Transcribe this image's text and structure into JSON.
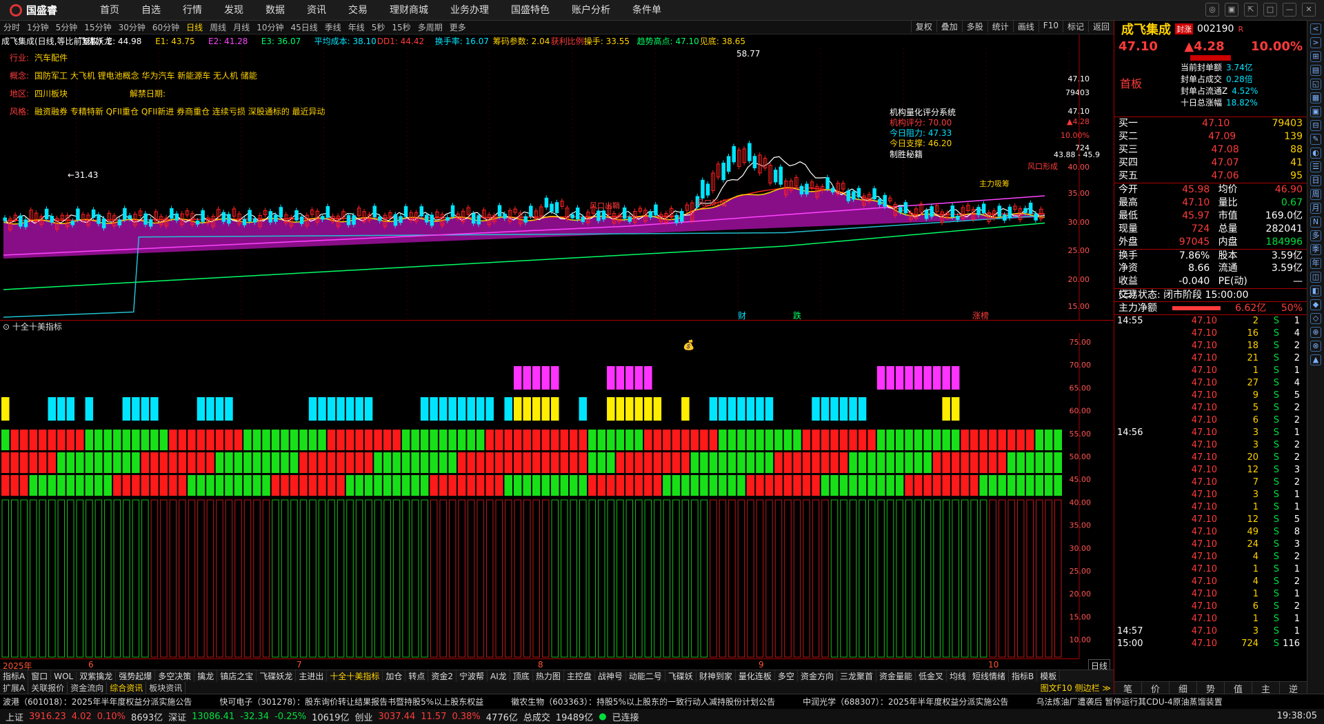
{
  "app": {
    "logo": "国盛睿",
    "menu": [
      "首页",
      "自选",
      "行情",
      "发现",
      "数据",
      "资讯",
      "交易",
      "理财商城",
      "业务办理",
      "国盛特色",
      "账户分析",
      "条件单"
    ],
    "window_controls": [
      "◎",
      "▣",
      "⇱",
      "□",
      "—",
      "✕"
    ]
  },
  "timeframes": {
    "items": [
      "分时",
      "1分钟",
      "5分钟",
      "15分钟",
      "30分钟",
      "60分钟",
      "日线",
      "周线",
      "月线",
      "10分钟",
      "45日线",
      "季线",
      "年线",
      "5秒",
      "15秒",
      "多周期",
      "更多"
    ],
    "selected": "日线",
    "tools": [
      "复权",
      "叠加",
      "多股",
      "统计",
      "画线",
      "F10",
      "标记",
      "返回"
    ]
  },
  "chart_header": {
    "items": [
      {
        "t": "成飞集成(日线,等比前复权)",
        "c": "#ffffff"
      },
      {
        "t": "飞碟妖龙",
        "c": "#ffffff"
      },
      {
        "t": "E: 44.98",
        "c": "#ffffff"
      },
      {
        "t": "E1: 43.75",
        "c": "#ffd200"
      },
      {
        "t": "E2: 41.28",
        "c": "#ff44ff"
      },
      {
        "t": "E3: 36.07",
        "c": "#00ff66"
      },
      {
        "t": "平均成本: 38.10",
        "c": "#00e5ff"
      },
      {
        "t": "DD1: 44.42",
        "c": "#ff3b3b"
      },
      {
        "t": "换手率: 16.07",
        "c": "#00e5ff"
      },
      {
        "t": "筹码参数: 2.04",
        "c": "#ffd200"
      },
      {
        "t": "获利比例:",
        "c": "#ff3b3b"
      },
      {
        "t": "操手: 33.55",
        "c": "#ffd200"
      },
      {
        "t": "趋势高点: 47.10",
        "c": "#00ff66"
      },
      {
        "t": "见底: 38.65",
        "c": "#ffd200"
      }
    ]
  },
  "info_lines": [
    {
      "label": "行业:",
      "text": "汽车配件"
    },
    {
      "label": "概念:",
      "text": "国防军工 大飞机 锂电池概念 华为汽车 新能源车 无人机 储能"
    },
    {
      "label": "地区:",
      "text": "四川板块",
      "extra": "解禁日期:"
    },
    {
      "label": "风格:",
      "text": "融资融券 专精特新 QFII重仓 QFII新进 券商重仓 连续亏损 深股通标的 最近异动"
    }
  ],
  "annotations": {
    "peak": "58.77",
    "low": "31.43",
    "score_title": "机构量化评分系统",
    "score": "机构评分: 70.00",
    "resistance": "今日阻力: 47.33",
    "support": "今日支撑: 46.20",
    "strategy": "制胜秘籍",
    "range": "43.88 - 45.9",
    "markers": [
      "财",
      "跌",
      "涨榜"
    ],
    "signals": [
      "风口出鞘",
      "风口形成",
      "主力吸筹",
      "风口形成"
    ]
  },
  "main_yaxis": [
    "47.10",
    "79403",
    "47.10",
    "▲4.28",
    "10.00%",
    "724",
    "40.00",
    "35.00",
    "30.00",
    "25.00",
    "20.00",
    "15.00"
  ],
  "sub_indicator": {
    "title": "十全十美指标",
    "yaxis": [
      "75.00",
      "70.00",
      "65.00",
      "60.00",
      "55.00",
      "50.00",
      "45.00",
      "40.00",
      "35.00",
      "30.00",
      "25.00",
      "20.00",
      "15.00",
      "10.00"
    ]
  },
  "dates": [
    "2025年",
    "6",
    "7",
    "8",
    "9",
    "10"
  ],
  "period_btn": "日线",
  "indicator_tabs": [
    "指标A",
    "窗口",
    "WOL",
    "双紫擒龙",
    "强势起爆",
    "多空决策",
    "擒龙",
    "镇店之宝",
    "飞碟妖龙",
    "主进出",
    "十全十美指标",
    "加仓",
    "转点",
    "资金2",
    "宁波帮",
    "AI龙",
    "顶底",
    "热力图",
    "主控盘",
    "战神号",
    "动能二号",
    "飞碟妖",
    "财神到家",
    "量化连板",
    "多空",
    "资金方向",
    "三龙聚首",
    "资金量能",
    "低金叉",
    "均线",
    "短线情绪",
    "指标B",
    "模板"
  ],
  "indicator_selected": "十全十美指标",
  "ext_tabs": [
    "扩展A",
    "关联报价",
    "资金流向",
    "综合资讯",
    "板块资讯"
  ],
  "ext_selected": "综合资讯",
  "ext_right": "图文F10 侧边栏 ≫",
  "news": [
    "波港（601018）：2025年半年度权益分派实施公告",
    "快可电子（301278）：股东询价转让结果报告书暨持股5%以上股东权益",
    "徽农生物（603363）：持股5%以上股东的一致行动人减持股份计划公告",
    "中润光学（688307）：2025年半年度权益分派实施公告",
    "乌法炼油厂遭袭后 暂停运行其CDU-4原油蒸馏装置"
  ],
  "status": {
    "sh_label": "上证",
    "sh": "3916.23",
    "sh_chg": "4.02",
    "sh_pct": "0.10%",
    "sh_amt": "8693亿",
    "sz_label": "深证",
    "sz": "13086.41",
    "sz_chg": "-32.34",
    "sz_pct": "-0.25%",
    "sz_amt": "10619亿",
    "cy_label": "创业",
    "cy": "3037.44",
    "cy_chg": "11.57",
    "cy_pct": "0.38%",
    "cy_amt": "4776亿",
    "total_label": "总成交",
    "total": "19489亿",
    "conn": "已连接",
    "time": "19:38:05"
  },
  "quote": {
    "name": "成飞集成",
    "tag": "封涨",
    "code": "002190",
    "r": "R",
    "price": "47.10",
    "change": "▲4.28",
    "pct": "10.00%",
    "board": "首板",
    "seal": [
      {
        "k": "当前封单额",
        "v": "3.74亿"
      },
      {
        "k": "封单占成交",
        "v": "0.28倍"
      },
      {
        "k": "封单占流通Z",
        "v": "4.52%"
      },
      {
        "k": "十日总涨幅",
        "v": "18.82%"
      }
    ],
    "book": [
      {
        "k": "买一",
        "p": "47.10",
        "v": "79403"
      },
      {
        "k": "买二",
        "p": "47.09",
        "v": "139"
      },
      {
        "k": "买三",
        "p": "47.08",
        "v": "88"
      },
      {
        "k": "买四",
        "p": "47.07",
        "v": "41"
      },
      {
        "k": "买五",
        "p": "47.06",
        "v": "95"
      }
    ],
    "stats": [
      {
        "k1": "今开",
        "v1": "45.98",
        "c1": "red",
        "k2": "均价",
        "v2": "46.90",
        "c2": "red"
      },
      {
        "k1": "最高",
        "v1": "47.10",
        "c1": "red",
        "k2": "量比",
        "v2": "0.67",
        "c2": "grn"
      },
      {
        "k1": "最低",
        "v1": "45.97",
        "c1": "red",
        "k2": "市值",
        "v2": "169.0亿",
        "c2": "wht"
      },
      {
        "k1": "现量",
        "v1": "724",
        "c1": "red",
        "k2": "总量",
        "v2": "282041",
        "c2": "wht"
      },
      {
        "k1": "外盘",
        "v1": "97045",
        "c1": "red",
        "k2": "内盘",
        "v2": "184996",
        "c2": "grn"
      },
      {
        "k1": "换手",
        "v1": "7.86%",
        "c1": "wht",
        "k2": "股本",
        "v2": "3.59亿",
        "c2": "wht"
      },
      {
        "k1": "净资",
        "v1": "8.66",
        "c1": "wht",
        "k2": "流通",
        "v2": "3.59亿",
        "c2": "wht"
      },
      {
        "k1": "收益(三)",
        "v1": "-0.040",
        "c1": "wht",
        "k2": "PE(动)",
        "v2": "—",
        "c2": "wht"
      }
    ],
    "trade_state": "交易状态: 闭市阶段 15:00:00",
    "flow_label": "主力净额",
    "flow": "6.62亿",
    "flow_pct": "50%",
    "ticks": [
      {
        "t": "14:55",
        "p": "47.10",
        "v": "2",
        "s": "S",
        "n": "1"
      },
      {
        "t": "",
        "p": "47.10",
        "v": "16",
        "s": "S",
        "n": "4"
      },
      {
        "t": "",
        "p": "47.10",
        "v": "18",
        "s": "S",
        "n": "2"
      },
      {
        "t": "",
        "p": "47.10",
        "v": "21",
        "s": "S",
        "n": "2"
      },
      {
        "t": "",
        "p": "47.10",
        "v": "1",
        "s": "S",
        "n": "1"
      },
      {
        "t": "",
        "p": "47.10",
        "v": "27",
        "s": "S",
        "n": "4"
      },
      {
        "t": "",
        "p": "47.10",
        "v": "9",
        "s": "S",
        "n": "5"
      },
      {
        "t": "",
        "p": "47.10",
        "v": "5",
        "s": "S",
        "n": "2"
      },
      {
        "t": "",
        "p": "47.10",
        "v": "6",
        "s": "S",
        "n": "2"
      },
      {
        "t": "14:56",
        "p": "47.10",
        "v": "3",
        "s": "S",
        "n": "1"
      },
      {
        "t": "",
        "p": "47.10",
        "v": "3",
        "s": "S",
        "n": "2"
      },
      {
        "t": "",
        "p": "47.10",
        "v": "20",
        "s": "S",
        "n": "2"
      },
      {
        "t": "",
        "p": "47.10",
        "v": "12",
        "s": "S",
        "n": "3"
      },
      {
        "t": "",
        "p": "47.10",
        "v": "7",
        "s": "S",
        "n": "2"
      },
      {
        "t": "",
        "p": "47.10",
        "v": "3",
        "s": "S",
        "n": "1"
      },
      {
        "t": "",
        "p": "47.10",
        "v": "1",
        "s": "S",
        "n": "1"
      },
      {
        "t": "",
        "p": "47.10",
        "v": "12",
        "s": "S",
        "n": "5"
      },
      {
        "t": "",
        "p": "47.10",
        "v": "49",
        "s": "S",
        "n": "8"
      },
      {
        "t": "",
        "p": "47.10",
        "v": "24",
        "s": "S",
        "n": "3"
      },
      {
        "t": "",
        "p": "47.10",
        "v": "4",
        "s": "S",
        "n": "2"
      },
      {
        "t": "",
        "p": "47.10",
        "v": "1",
        "s": "S",
        "n": "1"
      },
      {
        "t": "",
        "p": "47.10",
        "v": "4",
        "s": "S",
        "n": "2"
      },
      {
        "t": "",
        "p": "47.10",
        "v": "1",
        "s": "S",
        "n": "1"
      },
      {
        "t": "",
        "p": "47.10",
        "v": "6",
        "s": "S",
        "n": "2"
      },
      {
        "t": "",
        "p": "47.10",
        "v": "1",
        "s": "S",
        "n": "1"
      },
      {
        "t": "14:57",
        "p": "47.10",
        "v": "3",
        "s": "S",
        "n": "1"
      },
      {
        "t": "15:00",
        "p": "47.10",
        "v": "724",
        "s": "S",
        "n": "116"
      }
    ],
    "bottom_tabs": [
      "笔",
      "价",
      "细",
      "势",
      "值",
      "主",
      "逆"
    ]
  },
  "sidebar_icons": [
    "<",
    ">",
    "⊞",
    "▤",
    "◱",
    "▦",
    "▣",
    "⊟",
    "✎",
    "◐",
    "☰",
    "日",
    "周",
    "月",
    "N",
    "多",
    "季",
    "年",
    "◫",
    "◧",
    "◆",
    "◇",
    "⊕",
    "⊗",
    "▲"
  ],
  "colors": {
    "up": "#ff3b3b",
    "down": "#00e03c",
    "yellow": "#ffd200",
    "cyan": "#00e5ff",
    "magenta": "#ff44ff",
    "green_line": "#00ff66",
    "border": "#aa0000"
  }
}
